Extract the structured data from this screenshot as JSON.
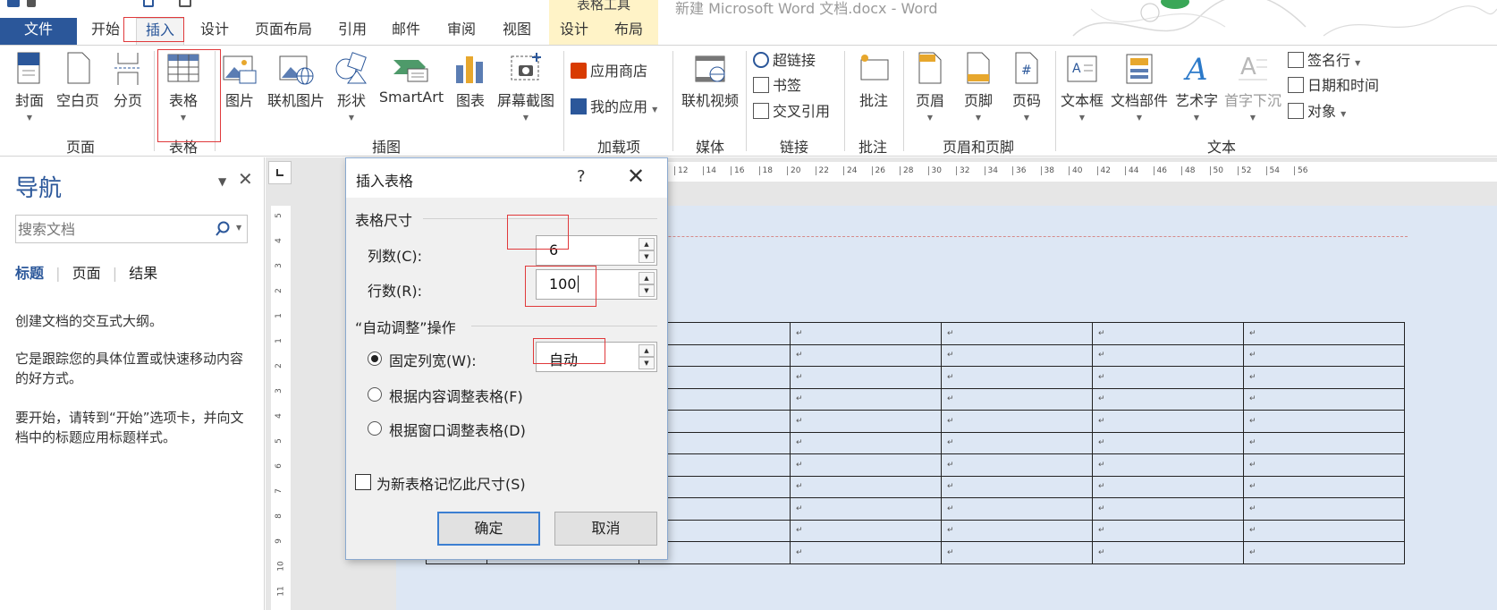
{
  "window": {
    "doc_title": "新建 Microsoft Word 文档.docx - Word",
    "context_group": "表格工具"
  },
  "tabs": [
    {
      "label": "文件"
    },
    {
      "label": "开始"
    },
    {
      "label": "插入"
    },
    {
      "label": "设计"
    },
    {
      "label": "页面布局"
    },
    {
      "label": "引用"
    },
    {
      "label": "邮件"
    },
    {
      "label": "审阅"
    },
    {
      "label": "视图"
    },
    {
      "label": "设计"
    },
    {
      "label": "布局"
    }
  ],
  "ribbon": {
    "buttons": {
      "cover": "封面",
      "blank": "空白页",
      "pagebreak": "分页",
      "table": "表格",
      "picture": "图片",
      "online_picture": "联机图片",
      "shapes": "形状",
      "smartart": "SmartArt",
      "chart": "图表",
      "screenshot": "屏幕截图",
      "store": "应用商店",
      "myapps": "我的应用",
      "online_video": "联机视频",
      "hyperlink": "超链接",
      "bookmark": "书签",
      "crossref": "交叉引用",
      "comment": "批注",
      "header": "页眉",
      "footer": "页脚",
      "pagenum": "页码",
      "textbox": "文本框",
      "quickparts": "文档部件",
      "wordart": "艺术字",
      "dropcap": "首字下沉",
      "signature": "签名行",
      "datetime": "日期和时间",
      "object": "对象"
    },
    "groups": {
      "pages": "页面",
      "tables": "表格",
      "illustrations": "插图",
      "addins": "加载项",
      "media": "媒体",
      "links": "链接",
      "comments": "批注",
      "headerfooter": "页眉和页脚",
      "text": "文本"
    }
  },
  "nav": {
    "title": "导航",
    "search_placeholder": "搜索文档",
    "tabs": [
      "标题",
      "页面",
      "结果"
    ],
    "p1": "创建文档的交互式大纲。",
    "p2": "它是跟踪您的具体位置或快速移动内容的好方式。",
    "p3": "要开始，请转到“开始”选项卡，并向文档中的标题应用标题样式。"
  },
  "ruler": {
    "h_ticks": [
      "12",
      "14",
      "16",
      "18",
      "20",
      "22",
      "24",
      "26",
      "28",
      "30",
      "32",
      "34",
      "36",
      "38",
      "40",
      "42",
      "44",
      "46",
      "48",
      "50",
      "52",
      "54",
      "56"
    ],
    "v_ticks": [
      "5",
      "4",
      "3",
      "2",
      "1",
      "1",
      "2",
      "3",
      "4",
      "5",
      "6",
      "7",
      "8",
      "9",
      "10",
      "11"
    ]
  },
  "dialog": {
    "title": "插入表格",
    "help": "?",
    "close": "✕",
    "section_size": "表格尺寸",
    "cols_label": "列数(C):",
    "cols_value": "6",
    "rows_label": "行数(R):",
    "rows_value": "100",
    "section_autofit": "“自动调整”操作",
    "fixed_label": "固定列宽(W):",
    "fixed_value": "自动",
    "autofit_content": "根据内容调整表格(F)",
    "autofit_window": "根据窗口调整表格(D)",
    "remember": "为新表格记忆此尺寸(S)",
    "ok": "确定",
    "cancel": "取消"
  },
  "table": {
    "cell_mark": "↵",
    "rows": 11,
    "cols": 7
  },
  "colors": {
    "brand": "#2b579a",
    "context_tab": "#fff3c7",
    "annotation_red": "#e0393b",
    "page_fill": "#dde7f4"
  }
}
